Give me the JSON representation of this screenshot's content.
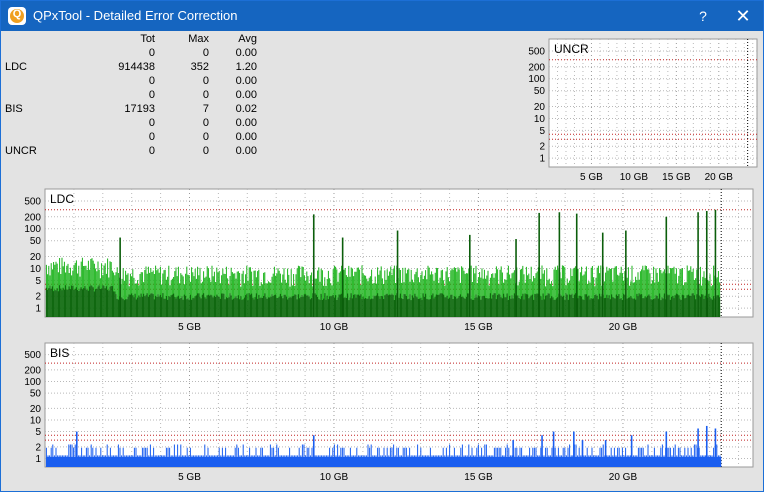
{
  "window": {
    "title": "QPxTool - Detailed Error Correction",
    "help_label": "?",
    "close_label": "✕",
    "app_icon_letter": "Q"
  },
  "stats": {
    "headers": [
      "",
      "Tot",
      "Max",
      "Avg"
    ],
    "rows": [
      [
        "",
        "0",
        "0",
        "0.00"
      ],
      [
        "LDC",
        "914438",
        "352",
        "1.20"
      ],
      [
        "",
        "0",
        "0",
        "0.00"
      ],
      [
        "",
        "0",
        "0",
        "0.00"
      ],
      [
        "BIS",
        "17193",
        "7",
        "0.02"
      ],
      [
        "",
        "0",
        "0",
        "0.00"
      ],
      [
        "",
        "0",
        "0",
        "0.00"
      ],
      [
        "UNCR",
        "0",
        "0",
        "0.00"
      ]
    ]
  },
  "chart_data": [
    {
      "type": "bar",
      "title": "UNCR",
      "y_scale": "log",
      "y_ticks": [
        "500",
        "200",
        "100",
        "50",
        "20",
        "10",
        "5",
        "2",
        "1"
      ],
      "x_ticks": [
        "5 GB",
        "10 GB",
        "15 GB",
        "20 GB"
      ],
      "xlim": [
        0,
        24.5
      ],
      "x_end": 23.4,
      "values": [],
      "color": "#000000"
    },
    {
      "type": "bar",
      "title": "LDC",
      "y_scale": "log",
      "y_ticks": [
        "500",
        "200",
        "100",
        "50",
        "20",
        "10",
        "5",
        "2",
        "1"
      ],
      "x_ticks": [
        "5 GB",
        "10 GB",
        "15 GB",
        "20 GB"
      ],
      "xlim": [
        0,
        24.5
      ],
      "x_end": 23.4,
      "typical_peak": 10,
      "max": 352,
      "color_peak": "#19b219",
      "color_base": "#0b5e0b",
      "spikes": [
        [
          2.6,
          60
        ],
        [
          9.3,
          230
        ],
        [
          10.3,
          60
        ],
        [
          12.2,
          90
        ],
        [
          14.7,
          70
        ],
        [
          16.3,
          55
        ],
        [
          17.1,
          250
        ],
        [
          17.8,
          260
        ],
        [
          18.4,
          240
        ],
        [
          19.3,
          80
        ],
        [
          20.1,
          90
        ],
        [
          21.5,
          200
        ],
        [
          22.6,
          260
        ],
        [
          22.9,
          280
        ],
        [
          23.2,
          300
        ]
      ]
    },
    {
      "type": "bar",
      "title": "BIS",
      "y_scale": "log",
      "y_ticks": [
        "500",
        "200",
        "100",
        "50",
        "20",
        "10",
        "5",
        "2",
        "1"
      ],
      "x_ticks": [
        "5 GB",
        "10 GB",
        "15 GB",
        "20 GB"
      ],
      "xlim": [
        0,
        24.5
      ],
      "x_end": 23.4,
      "max": 7,
      "color": "#1a5ef0",
      "spikes": [
        [
          1.1,
          5
        ],
        [
          9.3,
          4
        ],
        [
          16.2,
          3
        ],
        [
          17.2,
          4
        ],
        [
          17.6,
          5
        ],
        [
          18.3,
          5
        ],
        [
          18.6,
          3
        ],
        [
          19.4,
          3
        ],
        [
          20.3,
          4
        ],
        [
          21.5,
          5
        ],
        [
          22.6,
          6
        ],
        [
          22.9,
          7
        ],
        [
          23.2,
          6
        ]
      ]
    }
  ],
  "colors": {
    "title_bar": "#1565c0",
    "client_bg": "#e3e3e3",
    "plot_bg": "#ffffff",
    "grid": "#b9b9b9",
    "limit_line": "#c02020"
  }
}
